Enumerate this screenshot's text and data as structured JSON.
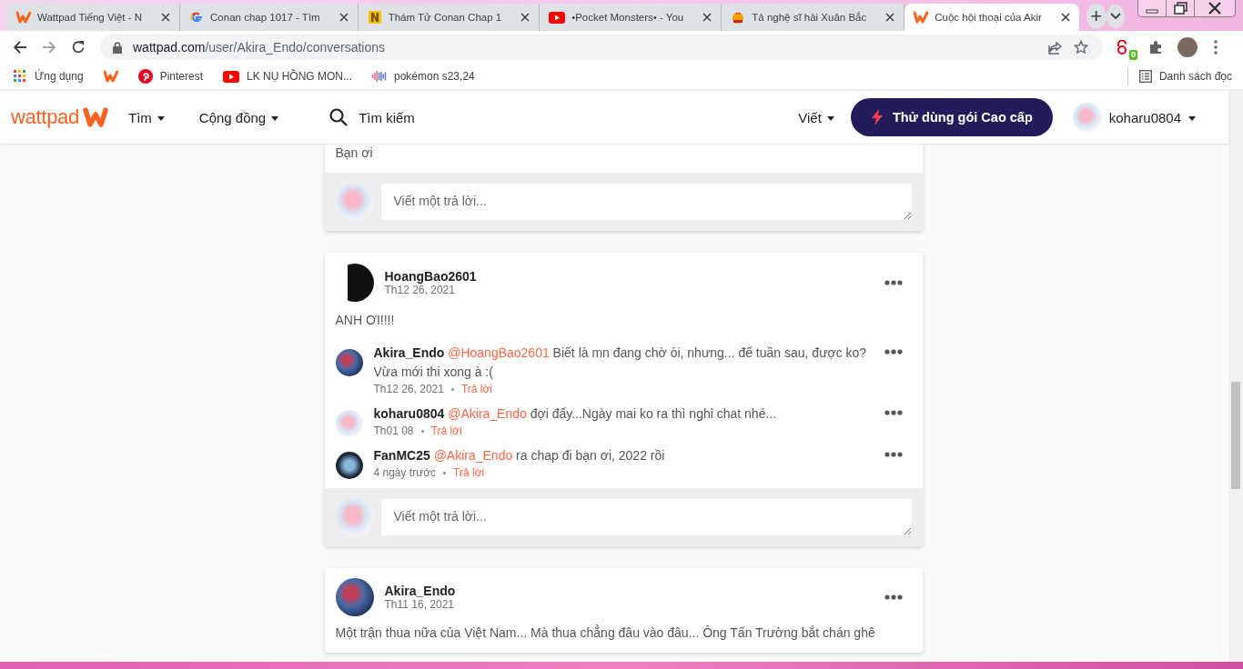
{
  "browser": {
    "tabs": [
      {
        "kind": "wattpad",
        "title": "Wattpad Tiếng Việt - N",
        "selected": false
      },
      {
        "kind": "google",
        "title": "Conan chap 1017 - Tìm",
        "selected": false
      },
      {
        "kind": "letter",
        "title": "Thám Tử Conan Chap 1",
        "selected": false
      },
      {
        "kind": "video",
        "title": "•Pocket Monsters• - You",
        "selected": false
      },
      {
        "kind": "mascot",
        "title": "Tả nghệ sĩ hài Xuân Bắc",
        "selected": false
      },
      {
        "kind": "wattpad",
        "title": "Cuộc hội thoại của Akir",
        "selected": true
      }
    ],
    "new_tab": "+",
    "url_host": "wattpad.com",
    "url_path": "/user/Akira_Endo/conversations",
    "extension_badge": "0",
    "bookmarks": [
      {
        "kind": "apps",
        "label": "Ứng dụng"
      },
      {
        "kind": "wattpad"
      },
      {
        "kind": "pinterest",
        "label": "Pinterest"
      },
      {
        "kind": "video",
        "label": "LK NỤ HỒNG MON..."
      },
      {
        "kind": "audio",
        "label": "pokémon s23,24"
      }
    ],
    "reading_list": "Danh sách đọc"
  },
  "site": {
    "logo": "wattpad",
    "nav": [
      "Tìm",
      "Cộng đồng"
    ],
    "search": "Tìm kiếm",
    "write": "Viết",
    "premium": "Thử dùng gói Cao cấp",
    "user": "koharu0804"
  },
  "threads": [
    {
      "partial": true,
      "body": "Bạn ơi",
      "reply_placeholder": "Viết một trả lời..."
    },
    {
      "partial": false,
      "author": "HoangBao2601",
      "date": "Th12 26, 2021",
      "body": "ANH ƠI!!!!",
      "replies": [
        {
          "author": "Akira_Endo",
          "mention": "@HoangBao2601",
          "text": "Biết là mn đang chờ òi, nhưng... để tuần sau, được ko? Vừa mới thi xong à :(",
          "date": "Th12 26, 2021",
          "action": "Trả lời"
        },
        {
          "author": "koharu0804",
          "mention": "@Akira_Endo",
          "text": "đợi đấy...Ngày mai ko ra thì nghỉ chat nhé...",
          "date": "Th01 08",
          "action": "Trả lời"
        },
        {
          "author": "FanMC25",
          "mention": "@Akira_Endo",
          "text": "ra chap đi bạn ơi, 2022 rồi",
          "date": "4 ngày trước",
          "action": "Trả lời"
        }
      ],
      "reply_placeholder": "Viết một trả lời..."
    },
    {
      "partial": false,
      "author": "Akira_Endo",
      "date": "Th11 16, 2021",
      "body": "Một trận thua nữa của Việt Nam... Mà thua chẳng đâu vào đâu... Ông Tấn Trường bắt chán ghê"
    }
  ]
}
